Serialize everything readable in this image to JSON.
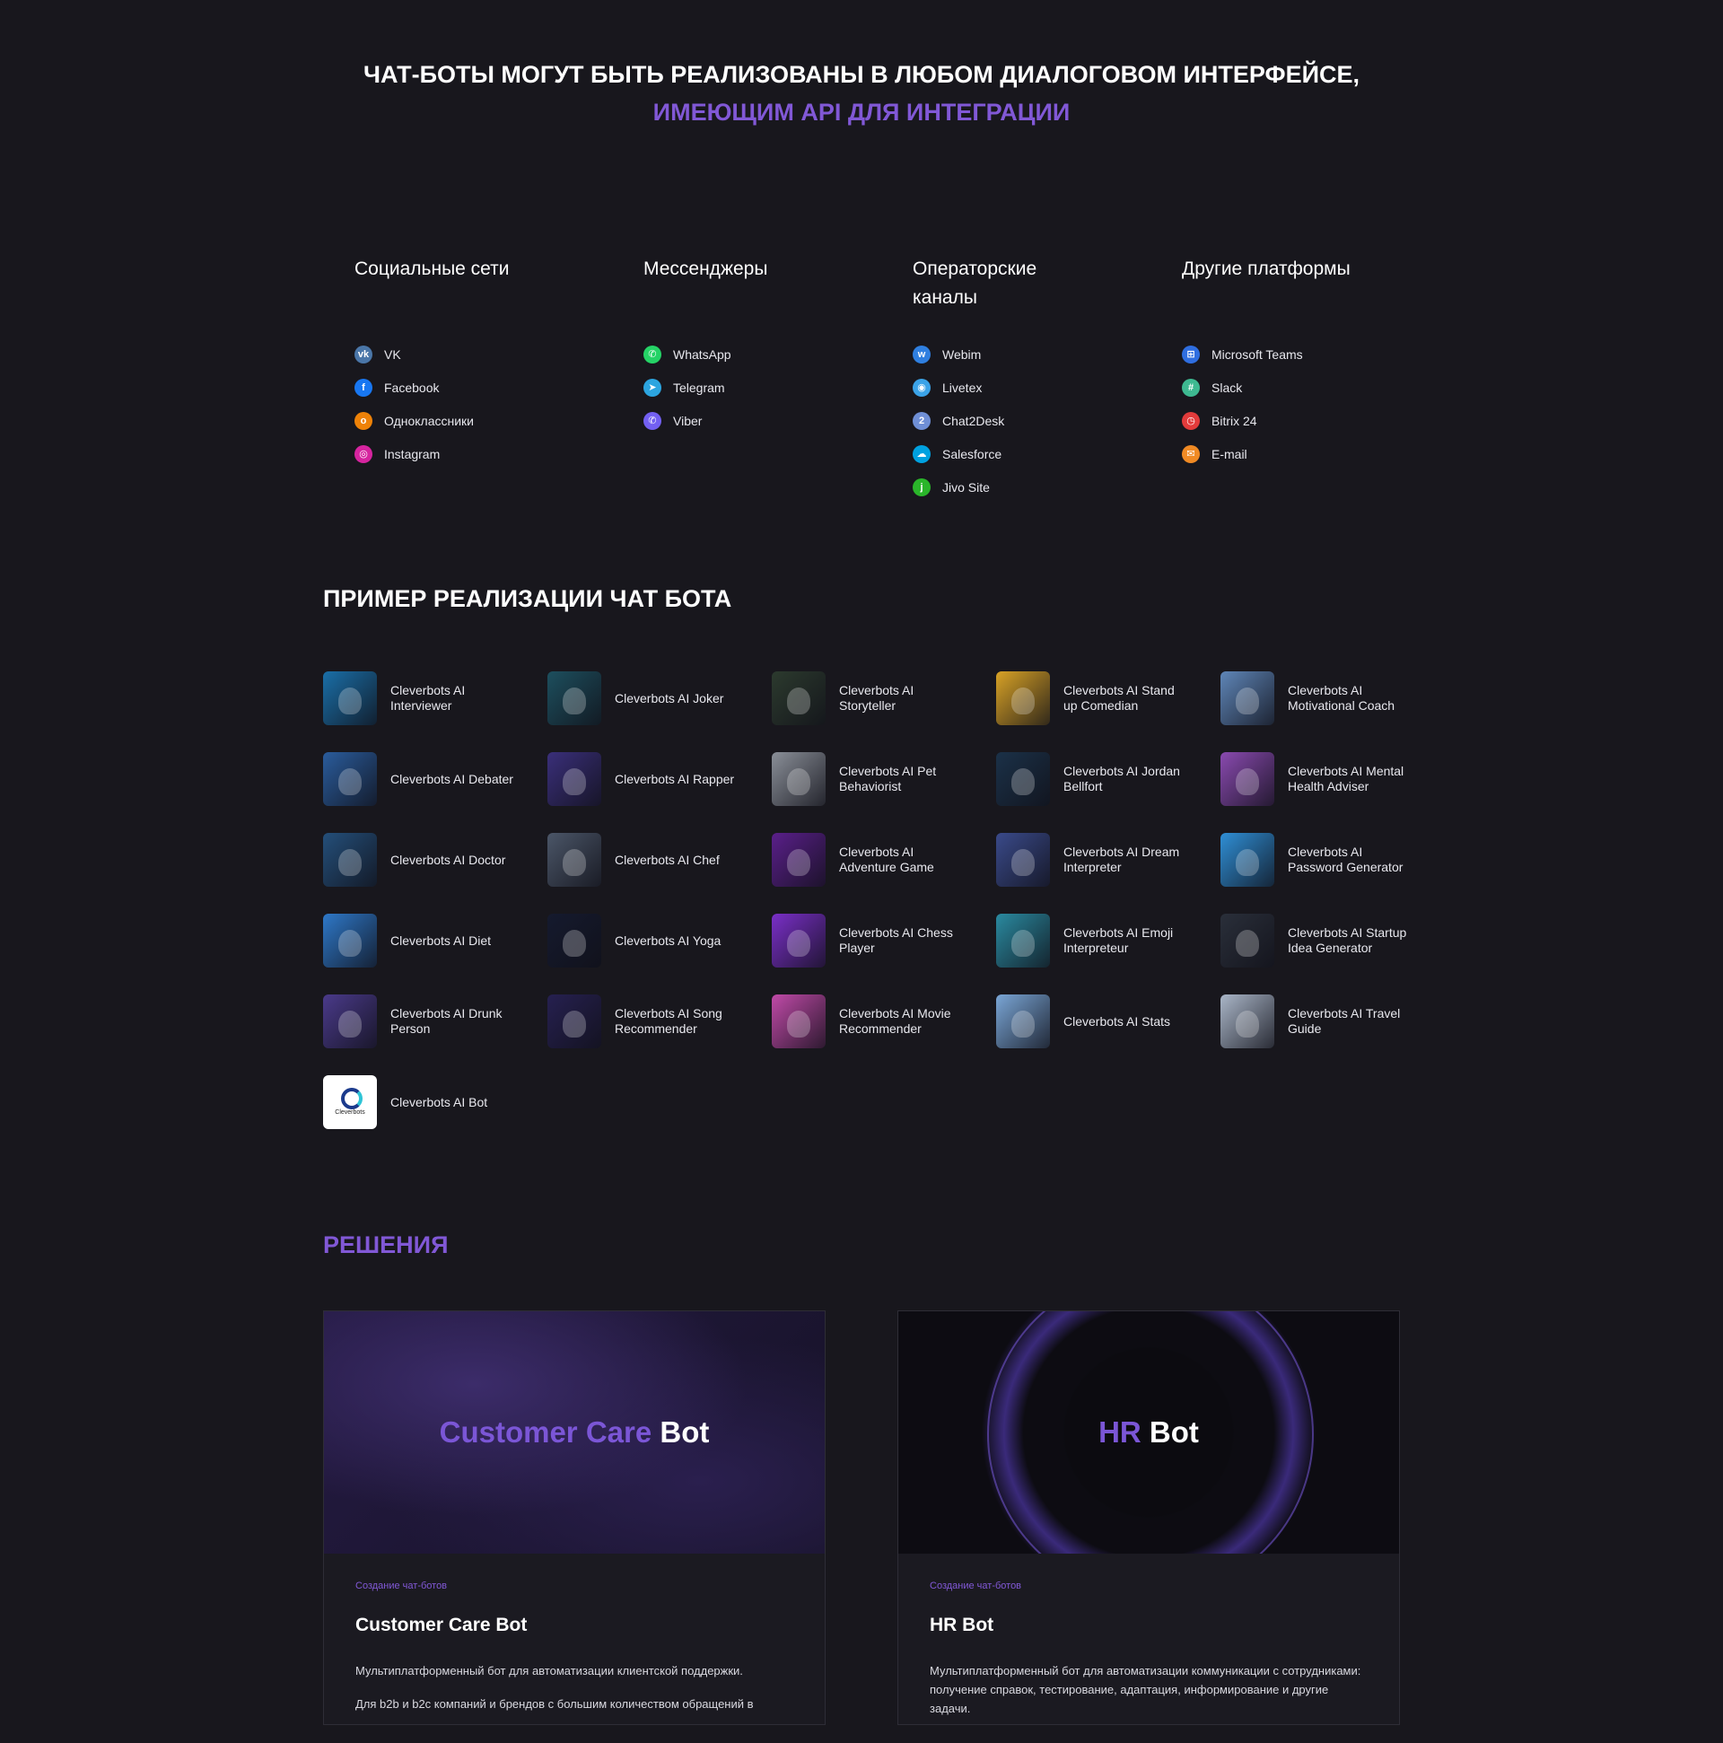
{
  "headline": {
    "line1": "ЧАТ-БОТЫ МОГУТ БЫТЬ РЕАЛИЗОВАНЫ В ЛЮБОМ ДИАЛОГОВОМ ИНТЕРФЕЙСЕ,",
    "line2": "ИМЕЮЩИМ API ДЛЯ ИНТЕГРАЦИИ"
  },
  "channels": [
    {
      "title": "Социальные сети",
      "items": [
        {
          "label": "VK",
          "icon": "vk-icon",
          "color": "#4a76a8",
          "glyph": "vk"
        },
        {
          "label": "Facebook",
          "icon": "facebook-icon",
          "color": "#1877f2",
          "glyph": "f"
        },
        {
          "label": "Одноклассники",
          "icon": "odnoklassniki-icon",
          "color": "#ee8208",
          "glyph": "о"
        },
        {
          "label": "Instagram",
          "icon": "instagram-icon",
          "color": "#d6249f",
          "glyph": "◎"
        }
      ]
    },
    {
      "title": "Мессенджеры",
      "items": [
        {
          "label": "WhatsApp",
          "icon": "whatsapp-icon",
          "color": "#25d366",
          "glyph": "✆"
        },
        {
          "label": "Telegram",
          "icon": "telegram-icon",
          "color": "#2ca5e0",
          "glyph": "➤"
        },
        {
          "label": "Viber",
          "icon": "viber-icon",
          "color": "#7360f2",
          "glyph": "✆"
        }
      ]
    },
    {
      "title": "Операторские каналы",
      "items": [
        {
          "label": "Webim",
          "icon": "webim-icon",
          "color": "#2f7fe0",
          "glyph": "w"
        },
        {
          "label": "Livetex",
          "icon": "livetex-icon",
          "color": "#3ba3e8",
          "glyph": "◉"
        },
        {
          "label": "Chat2Desk",
          "icon": "chat2desk-icon",
          "color": "#6f8fd6",
          "glyph": "2"
        },
        {
          "label": "Salesforce",
          "icon": "salesforce-icon",
          "color": "#00a1e0",
          "glyph": "☁"
        },
        {
          "label": "Jivo Site",
          "icon": "jivosite-icon",
          "color": "#2ab52a",
          "glyph": "j"
        }
      ]
    },
    {
      "title": "Другие платформы",
      "items": [
        {
          "label": "Microsoft Teams",
          "icon": "microsoft-teams-icon",
          "color": "#2f6ee0",
          "glyph": "⊞"
        },
        {
          "label": "Slack",
          "icon": "slack-icon",
          "color": "#3eb991",
          "glyph": "#"
        },
        {
          "label": "Bitrix 24",
          "icon": "bitrix24-icon",
          "color": "#e23b3b",
          "glyph": "◷"
        },
        {
          "label": "E-mail",
          "icon": "email-icon",
          "color": "#f08a24",
          "glyph": "✉"
        }
      ]
    }
  ],
  "examples_title": "ПРИМЕР РЕАЛИЗАЦИИ ЧАТ БОТА",
  "bots": [
    {
      "label": "Cleverbots AI Interviewer",
      "color": "#1a6fa8"
    },
    {
      "label": "Cleverbots AI Joker",
      "color": "#1d4f5e"
    },
    {
      "label": "Cleverbots AI Storyteller",
      "color": "#2c3a2e"
    },
    {
      "label": "Cleverbots AI Stand up Comedian",
      "color": "#d8a226"
    },
    {
      "label": "Cleverbots AI Motivational Coach",
      "color": "#5f86b8"
    },
    {
      "label": "Cleverbots AI Debater",
      "color": "#2a5c9c"
    },
    {
      "label": "Cleverbots AI Rapper",
      "color": "#3a2f7a"
    },
    {
      "label": "Cleverbots AI Pet Behaviorist",
      "color": "#8a8f98"
    },
    {
      "label": "Cleverbots AI Jordan Bellfort",
      "color": "#1b3148"
    },
    {
      "label": "Cleverbots AI Mental Health Adviser",
      "color": "#8a4ab0"
    },
    {
      "label": "Cleverbots AI Doctor",
      "color": "#244f7a"
    },
    {
      "label": "Cleverbots AI Chef",
      "color": "#4b5668"
    },
    {
      "label": "Cleverbots AI Adventure Game",
      "color": "#5a1f8a"
    },
    {
      "label": "Cleverbots AI Dream Interpreter",
      "color": "#3a4a8a"
    },
    {
      "label": "Cleverbots AI Password Generator",
      "color": "#2f8fd6"
    },
    {
      "label": "Cleverbots AI Diet",
      "color": "#2e78c8"
    },
    {
      "label": "Cleverbots AI Yoga",
      "color": "#151a2e"
    },
    {
      "label": "Cleverbots AI Chess Player",
      "color": "#7a2fc8"
    },
    {
      "label": "Cleverbots AI Emoji Interpreteur",
      "color": "#2a8aa0"
    },
    {
      "label": "Cleverbots AI Startup Idea Generator",
      "color": "#2a2f3a"
    },
    {
      "label": "Cleverbots AI Drunk Person",
      "color": "#4a3a8a"
    },
    {
      "label": "Cleverbots AI Song Recommender",
      "color": "#262050"
    },
    {
      "label": "Cleverbots AI Movie Recommender",
      "color": "#c04aa8"
    },
    {
      "label": "Cleverbots AI Stats",
      "color": "#7aa6d6"
    },
    {
      "label": "Cleverbots AI Travel Guide",
      "color": "#aab6c8"
    },
    {
      "label": "Cleverbots AI Bot",
      "logo": true,
      "logo_text": "Cleverbots"
    }
  ],
  "solutions_title": "РЕШЕНИЯ",
  "solutions": [
    {
      "banner_accent": "Customer Care",
      "banner_plain": "Bot",
      "tag": "Создание чат-ботов",
      "title": "Customer Care Bot",
      "desc": "Мультиплатформенный бот для автоматизации клиентской поддержки.",
      "desc2": "Для b2b и b2c компаний и брендов с большим количеством обращений в"
    },
    {
      "banner_accent": "HR",
      "banner_plain": "Bot",
      "tag": "Создание чат-ботов",
      "title": "HR Bot",
      "desc": "Мультиплатформенный бот для автоматизации коммуникации с сотрудниками: получение справок, тестирование, адаптация, информирование и другие задачи.",
      "desc2": ""
    }
  ]
}
